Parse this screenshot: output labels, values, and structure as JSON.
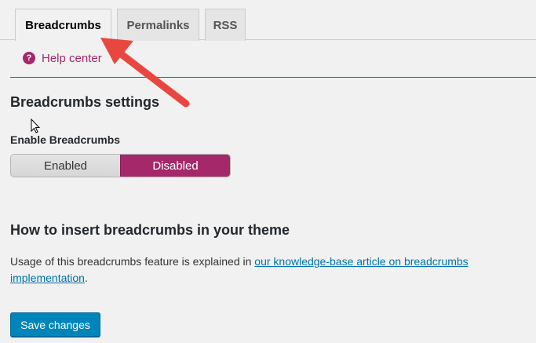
{
  "tabs": [
    {
      "label": "Breadcrumbs",
      "active": true
    },
    {
      "label": "Permalinks",
      "active": false
    },
    {
      "label": "RSS",
      "active": false
    }
  ],
  "help": {
    "label": "Help center",
    "icon": "question-circle-icon"
  },
  "settings": {
    "title": "Breadcrumbs settings",
    "enable_label": "Enable Breadcrumbs",
    "toggle": {
      "options": [
        "Enabled",
        "Disabled"
      ],
      "selected": "Disabled"
    }
  },
  "insert": {
    "title": "How to insert breadcrumbs in your theme",
    "text_before": "Usage of this breadcrumbs feature is explained in ",
    "link_text": "our knowledge-base article on breadcrumbs implementation",
    "text_after": "."
  },
  "save_button": "Save changes",
  "colors": {
    "accent": "#a4286a",
    "primary_button": "#0085ba",
    "annotation_arrow": "#e8473f"
  }
}
